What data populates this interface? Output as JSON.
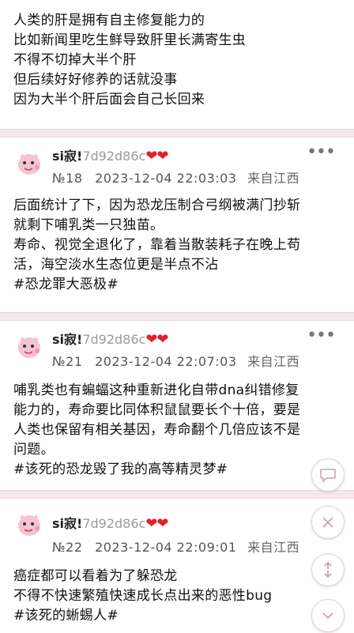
{
  "colors": {
    "accent": "#e0202a",
    "bg": "#f6e6ee",
    "fab_border": "#e7cfd8"
  },
  "top_post": {
    "lines": [
      "人类的肝是拥有自主修复能力的",
      "比如新闻里吃生鲜导致肝里长满寄生虫",
      "不得不切掉大半个肝",
      "但后续好好修养的话就没事",
      "因为大半个肝后面会自己长回来"
    ]
  },
  "comments": [
    {
      "username": "si寂!",
      "hash": "7d92d86c",
      "hearts": "❤❤",
      "floor": "№18",
      "date": "2023-12-04",
      "time": "22:03:03",
      "location": "来自江西",
      "lines": [
        "后面统计了下，因为恐龙压制合弓纲被满门抄斩",
        "就剩下哺乳类一只独苗。",
        "寿命、视觉全退化了，靠着当散装耗子在晚上苟",
        "活，海空淡水生态位更是半点不沾",
        "#恐龙罪大恶极#"
      ]
    },
    {
      "username": "si寂!",
      "hash": "7d92d86c",
      "hearts": "❤❤",
      "floor": "№21",
      "date": "2023-12-04",
      "time": "22:07:03",
      "location": "来自江西",
      "lines": [
        "哺乳类也有蝙蝠这种重新进化自带dna纠错修复",
        "能力的，寿命要比同体积鼠鼠要长个十倍，要是",
        "人类也保留有相关基因，寿命翻个几倍应该不是",
        "问题。",
        "#该死的恐龙毁了我的高等精灵梦#"
      ]
    },
    {
      "username": "si寂!",
      "hash": "7d92d86c",
      "hearts": "❤❤",
      "floor": "№22",
      "date": "2023-12-04",
      "time": "22:09:01",
      "location": "来自江西",
      "lines": [
        "癌症都可以看着为了躲恐龙",
        "不得不快速繁殖快速成长点出来的恶性bug",
        "#该死的蜥蜴人#"
      ]
    }
  ],
  "more_label": "•••",
  "fab_icons": [
    "comment-icon",
    "close-icon",
    "refresh-icon",
    "chevron-down-icon"
  ]
}
